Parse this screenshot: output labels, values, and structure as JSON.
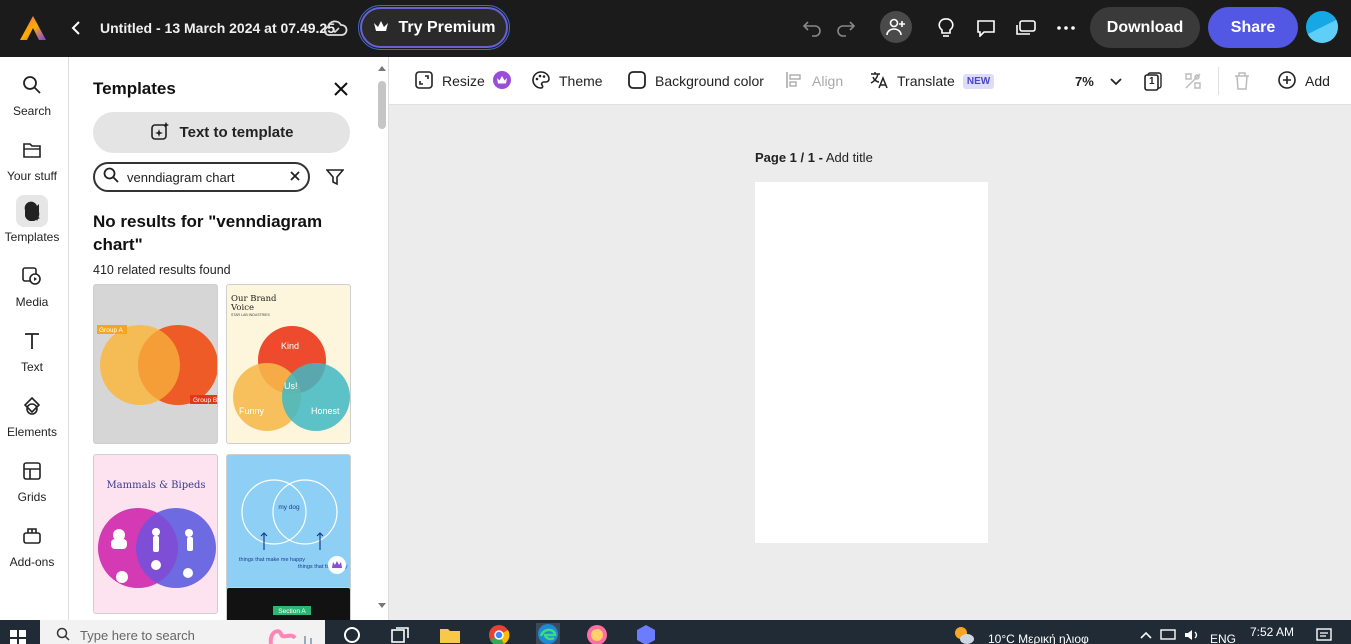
{
  "topbar": {
    "doc_title": "Untitled - 13 March 2024 at 07.49.25",
    "premium_label": "Try Premium",
    "download_label": "Download",
    "share_label": "Share"
  },
  "rail": {
    "items": [
      {
        "label": "Search",
        "icon": "search-icon"
      },
      {
        "label": "Your stuff",
        "icon": "folder-icon"
      },
      {
        "label": "Templates",
        "icon": "templates-icon"
      },
      {
        "label": "Media",
        "icon": "media-icon"
      },
      {
        "label": "Text",
        "icon": "text-icon"
      },
      {
        "label": "Elements",
        "icon": "elements-icon"
      },
      {
        "label": "Grids",
        "icon": "grids-icon"
      },
      {
        "label": "Add-ons",
        "icon": "addons-icon"
      }
    ],
    "active": "Templates"
  },
  "panel": {
    "title": "Templates",
    "text_to_template": "Text to template",
    "search_value": "venndiagram chart",
    "no_results": "No results for \"venndiagram chart\"",
    "related": "410 related results found",
    "templates": [
      {
        "label_a": "Group A",
        "label_b": "Group B"
      },
      {
        "title": "Our Brand",
        "title2": "Voice",
        "subtitle": "STAR LAB INDUSTRIES",
        "circles": [
          "Kind",
          "Funny",
          "Honest"
        ],
        "center": "Us!"
      },
      {
        "title": "Mammals & Bipeds"
      },
      {
        "center": "my dog",
        "left_caption": "things that make me happy",
        "right_caption": "things that fart in my"
      },
      {
        "label": "Section A"
      }
    ]
  },
  "toolbar": {
    "resize": "Resize",
    "theme": "Theme",
    "background": "Background color",
    "align": "Align",
    "translate": "Translate",
    "translate_badge": "NEW",
    "zoom": "7%",
    "page_count": "1",
    "add": "Add"
  },
  "canvas": {
    "page_prefix": "Page 1 / 1 -",
    "page_title_placeholder": "Add title"
  },
  "taskbar": {
    "search_placeholder": "Type here to search",
    "weather": "10°C  Μερική ηλιοφ",
    "language": "ENG",
    "time": "7:52 AM"
  },
  "colors": {
    "accent": "#5258e4",
    "topbar": "#1b1b1b",
    "canvas_bg": "#ececec"
  }
}
